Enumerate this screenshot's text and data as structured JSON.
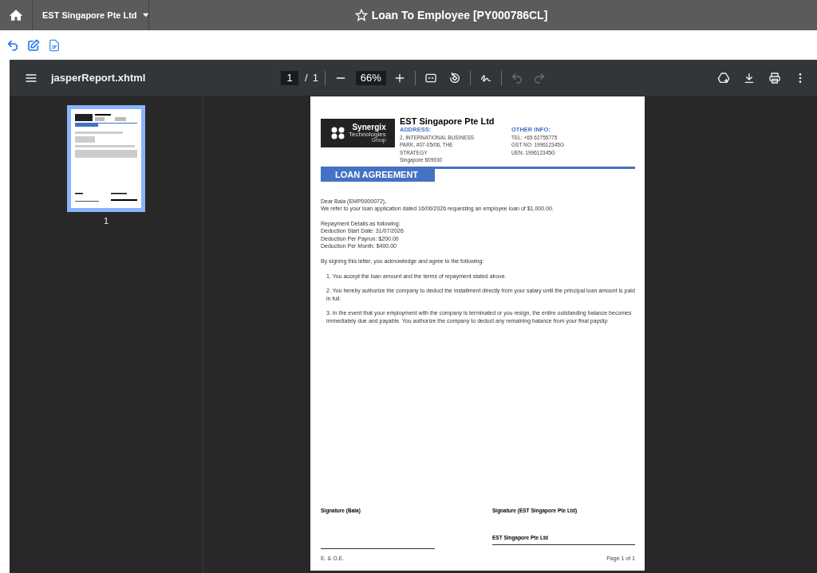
{
  "app_bar": {
    "company": "EST Singapore Pte Ltd",
    "title": "Loan To Employee [PY000786CL]",
    "favorite": false
  },
  "viewer": {
    "file_name": "jasperReport.xhtml",
    "page_current": "1",
    "page_separator": "/",
    "page_total": "1",
    "zoom": "66%",
    "undo_disabled": true,
    "redo_disabled": true,
    "thumbnails": [
      {
        "label": "1",
        "selected": true
      }
    ]
  },
  "document": {
    "logo": {
      "name": "Synergix",
      "sub": "Technologies",
      "group": "Group"
    },
    "company": "EST Singapore Pte Ltd",
    "address_label": "ADDRESS:",
    "address_lines": [
      "2, INTERNATIONAL BUSINESS",
      "PARK, #07-05/06, THE",
      "STRATEGY",
      "Singapore 609930"
    ],
    "other_label": "OTHER INFO:",
    "other_lines": [
      "TEL: +65 62755775",
      "GST NO: 199612345G",
      "UEN: 199612345G"
    ],
    "heading": "LOAN AGREEMENT",
    "blocks": [
      {
        "kind": "lines",
        "lines": [
          "Dear Bala (EMP0000072),",
          "We refer to your loan application dated 16/06/2026 requesting an employee loan of $1,000.00."
        ]
      },
      {
        "kind": "lines",
        "lines": [
          "Repayment Details as following:",
          "Deduction Start Date: 31/07/2026",
          "Deduction Per Payrun: $200.00",
          "Deduction Per Month: $400.00"
        ]
      },
      {
        "kind": "lines",
        "lines": [
          "By signing this letter, you acknowledge and agree to the following:"
        ]
      },
      {
        "kind": "item",
        "text": "1. You accept the loan amount and the terms of repayment stated above."
      },
      {
        "kind": "item",
        "text": "2. You hereby authorize the company to deduct the installment directly from your salary until the principal loan amount is paid in full."
      },
      {
        "kind": "item",
        "text": "3. In the event that your employment with the company is terminated or you resign, the entire outstanding balance becomes immediately due and payable. You authorize the company to deduct any remaining balance from your final payslip"
      }
    ],
    "signature_left": "Signature (Bala)",
    "signature_right": "Signature (EST Singapore Pte Ltd)",
    "signer_right": "EST Singapore Pte Ltd",
    "footer_left": "E. & O.E.",
    "footer_right": "Page 1 of 1"
  }
}
